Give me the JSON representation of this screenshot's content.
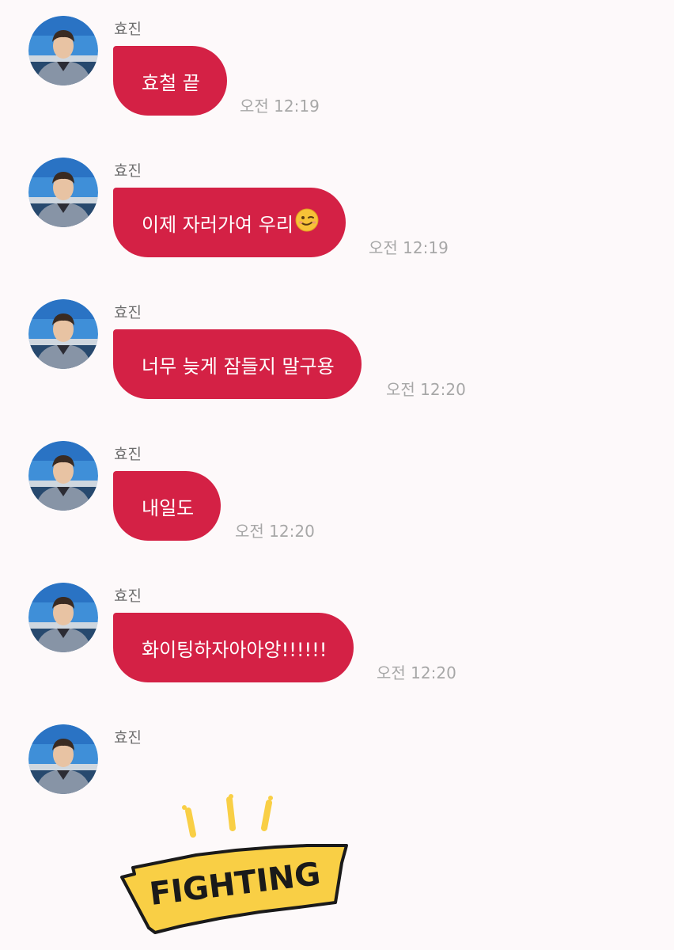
{
  "chat": {
    "messages": [
      {
        "sender": "효진",
        "text": "효철 끝",
        "time": "오전 12:19"
      },
      {
        "sender": "효진",
        "text": "이제 자러가여 우리",
        "emoji": "wink-smile-emoji",
        "time": "오전 12:19"
      },
      {
        "sender": "효진",
        "text": "너무 늦게 잠들지 말구용",
        "time": "오전 12:20"
      },
      {
        "sender": "효진",
        "text": "내일도",
        "time": "오전 12:20"
      },
      {
        "sender": "효진",
        "text": "화이팅하자아아앙!!!!!!",
        "time": "오전 12:20"
      },
      {
        "sender": "효진",
        "sticker": {
          "text": "FIGHTING",
          "color": "#f9cf45"
        }
      }
    ]
  },
  "colors": {
    "background": "#fdf9fa",
    "bubble": "#d42145",
    "bubble_text": "#ffffff",
    "sender": "#6d6d6d",
    "time": "#a7a7a7"
  }
}
